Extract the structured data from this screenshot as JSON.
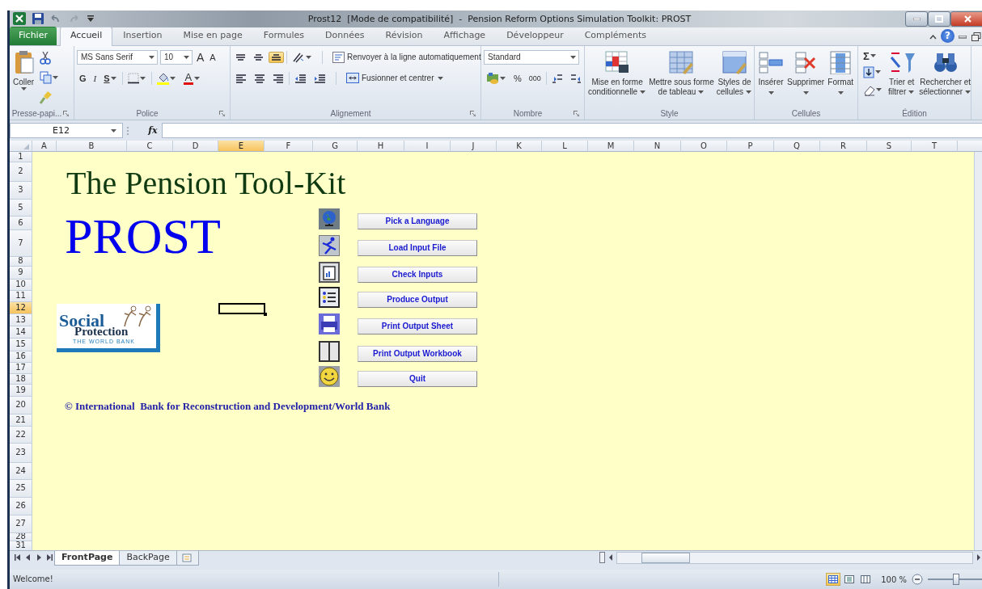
{
  "window": {
    "title": "Prost12  [Mode de compatibilité]  -  Pension Reform Options Simulation Toolkit: PROST"
  },
  "menu_tabs": [
    {
      "label": "Fichier",
      "kind": "file",
      "selected": false
    },
    {
      "label": "Accueil",
      "kind": "tab",
      "selected": true
    },
    {
      "label": "Insertion",
      "kind": "tab",
      "selected": false
    },
    {
      "label": "Mise en page",
      "kind": "tab",
      "selected": false
    },
    {
      "label": "Formules",
      "kind": "tab",
      "selected": false
    },
    {
      "label": "Données",
      "kind": "tab",
      "selected": false
    },
    {
      "label": "Révision",
      "kind": "tab",
      "selected": false
    },
    {
      "label": "Affichage",
      "kind": "tab",
      "selected": false
    },
    {
      "label": "Développeur",
      "kind": "tab",
      "selected": false
    },
    {
      "label": "Compléments",
      "kind": "tab",
      "selected": false
    }
  ],
  "help": "?",
  "ribbon": {
    "clipboard": {
      "paste": "Coller",
      "group": "Presse-papi..."
    },
    "font": {
      "name": "MS Sans Serif",
      "size": "10",
      "grow": "A",
      "shrink": "A",
      "bold": "G",
      "italic": "I",
      "underline": "S",
      "font_color": "A",
      "group": "Police"
    },
    "alignment": {
      "bottom_align_on": true,
      "wrap_text": "Renvoyer à la ligne automatiquement",
      "merge": "Fusionner et centrer",
      "group": "Alignement"
    },
    "number": {
      "format": "Standard",
      "percent": "%",
      "thousands": "000",
      "group": "Nombre"
    },
    "style": {
      "group": "Style",
      "buttons": [
        {
          "kind": "conditional",
          "lines": [
            "Mise en forme",
            "conditionnelle"
          ]
        },
        {
          "kind": "table",
          "lines": [
            "Mettre sous forme",
            "de tableau"
          ]
        },
        {
          "kind": "cellstyle",
          "lines": [
            "Styles de",
            "cellules"
          ]
        }
      ]
    },
    "cells": {
      "group": "Cellules",
      "buttons": [
        {
          "kind": "insert",
          "lines": [
            "Insérer"
          ]
        },
        {
          "kind": "delete",
          "lines": [
            "Supprimer"
          ]
        },
        {
          "kind": "format",
          "lines": [
            "Format"
          ]
        }
      ]
    },
    "editing": {
      "group": "Édition",
      "sum": "Σ",
      "buttons": [
        {
          "kind": "sort",
          "lines": [
            "Trier et",
            "filtrer"
          ]
        },
        {
          "kind": "find",
          "lines": [
            "Rechercher et",
            "sélectionner"
          ]
        }
      ]
    }
  },
  "formula_bar": {
    "name_box": "E12",
    "function_label": "fx"
  },
  "columns": [
    {
      "label": "A",
      "selected": false
    },
    {
      "label": "B",
      "selected": false
    },
    {
      "label": "C",
      "selected": false
    },
    {
      "label": "D",
      "selected": false
    },
    {
      "label": "E",
      "selected": true
    },
    {
      "label": "F",
      "selected": false
    },
    {
      "label": "G",
      "selected": false
    },
    {
      "label": "H",
      "selected": false
    },
    {
      "label": "I",
      "selected": false
    },
    {
      "label": "J",
      "selected": false
    },
    {
      "label": "K",
      "selected": false
    },
    {
      "label": "L",
      "selected": false
    },
    {
      "label": "M",
      "selected": false
    },
    {
      "label": "N",
      "selected": false
    },
    {
      "label": "O",
      "selected": false
    },
    {
      "label": "P",
      "selected": false
    },
    {
      "label": "Q",
      "selected": false
    },
    {
      "label": "R",
      "selected": false
    },
    {
      "label": "S",
      "selected": false
    },
    {
      "label": "T",
      "selected": false
    }
  ],
  "rows": [
    {
      "label": "1",
      "selected": false
    },
    {
      "label": "2",
      "selected": false
    },
    {
      "label": "3",
      "selected": false
    },
    {
      "label": "5",
      "selected": false
    },
    {
      "label": "6",
      "selected": false
    },
    {
      "label": "7",
      "selected": false
    },
    {
      "label": "8",
      "selected": false
    },
    {
      "label": "9",
      "selected": false
    },
    {
      "label": "10",
      "selected": false
    },
    {
      "label": "11",
      "selected": false
    },
    {
      "label": "12",
      "selected": true
    },
    {
      "label": "13",
      "selected": false
    },
    {
      "label": "14",
      "selected": false
    },
    {
      "label": "15",
      "selected": false
    },
    {
      "label": "16",
      "selected": false
    },
    {
      "label": "17",
      "selected": false
    },
    {
      "label": "18",
      "selected": false
    },
    {
      "label": "19",
      "selected": false
    },
    {
      "label": "20",
      "selected": false
    },
    {
      "label": "21",
      "selected": false
    },
    {
      "label": "22",
      "selected": false
    },
    {
      "label": "23",
      "selected": false
    },
    {
      "label": "24",
      "selected": false
    },
    {
      "label": "25",
      "selected": false
    },
    {
      "label": "26",
      "selected": false
    },
    {
      "label": "27",
      "selected": false
    },
    {
      "label": "28",
      "selected": false
    },
    {
      "label": "31",
      "selected": false
    }
  ],
  "sheet": {
    "title": "The Pension Tool-Kit",
    "product": "PROST",
    "logo": {
      "word1": "Social",
      "word2": "Protection",
      "tagline": "THE WORLD BANK"
    },
    "buttons": [
      {
        "label": "Pick a Language",
        "kind": "globe"
      },
      {
        "label": "Load Input File",
        "kind": "runner"
      },
      {
        "label": "Check Inputs",
        "kind": "document"
      },
      {
        "label": "Produce Output",
        "kind": "list"
      },
      {
        "label": "Print Output Sheet",
        "kind": "printer"
      },
      {
        "label": "Print Output Workbook",
        "kind": "book"
      },
      {
        "label": "Quit",
        "kind": "smiley"
      }
    ],
    "copyright": "© International  Bank for Reconstruction and Development/World Bank"
  },
  "sheet_tabs": [
    {
      "label": "FrontPage",
      "selected": true
    },
    {
      "label": "BackPage",
      "selected": false
    }
  ],
  "status_bar": {
    "message": "Welcome!",
    "zoom": "100 %",
    "level": 0.5
  }
}
